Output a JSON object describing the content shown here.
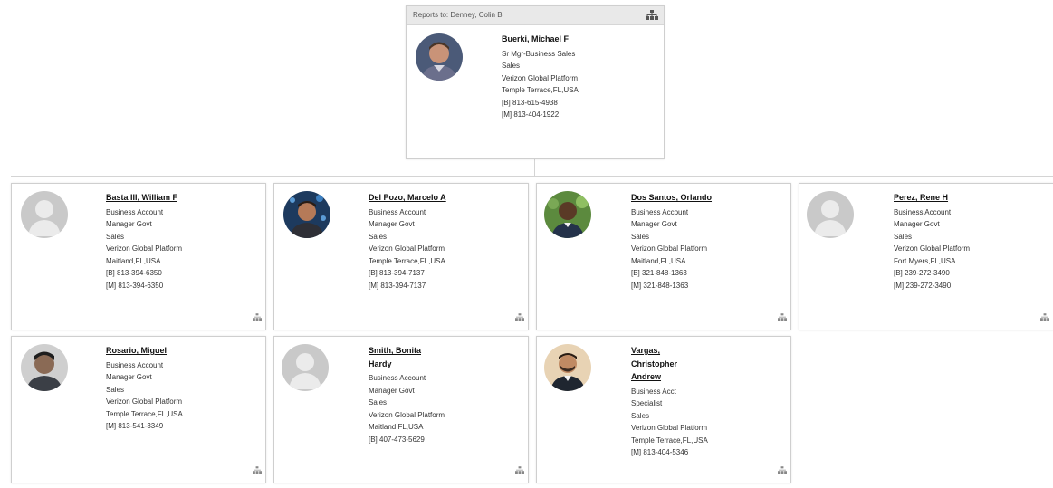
{
  "manager": {
    "reports_to": "Reports to: Denney, Colin B",
    "name": "Buerki, Michael F",
    "title": "Sr Mgr-Business Sales",
    "department": "Sales",
    "org": "Verizon Global Platform",
    "location": "Temple Terrace,FL,USA",
    "phone_b": "[B] 813-615-4938",
    "phone_m": "[M] 813-404-1922"
  },
  "reports": [
    {
      "name": "Basta III, William F",
      "title_lines": [
        "Business Account",
        "Manager Govt"
      ],
      "department": "Sales",
      "org": "Verizon Global Platform",
      "location": "Maitland,FL,USA",
      "phones": [
        "[B] 813-394-6350",
        "[M] 813-394-6350"
      ],
      "avatar": "placeholder"
    },
    {
      "name": "Del Pozo, Marcelo A",
      "title_lines": [
        "Business Account",
        "Manager Govt"
      ],
      "department": "Sales",
      "org": "Verizon Global Platform",
      "location": "Temple Terrace,FL,USA",
      "phones": [
        "[B] 813-394-7137",
        "[M] 813-394-7137"
      ],
      "avatar": "photo"
    },
    {
      "name": "Dos Santos, Orlando",
      "title_lines": [
        "Business Account",
        "Manager Govt"
      ],
      "department": "Sales",
      "org": "Verizon Global Platform",
      "location": "Maitland,FL,USA",
      "phones": [
        "[B] 321-848-1363",
        "[M] 321-848-1363"
      ],
      "avatar": "photo"
    },
    {
      "name": "Perez, Rene H",
      "title_lines": [
        "Business Account",
        "Manager Govt"
      ],
      "department": "Sales",
      "org": "Verizon Global Platform",
      "location": "Fort Myers,FL,USA",
      "phones": [
        "[B] 239-272-3490",
        "[M] 239-272-3490"
      ],
      "avatar": "placeholder"
    },
    {
      "name": "Rosario, Miguel",
      "title_lines": [
        "Business Account",
        "Manager Govt"
      ],
      "department": "Sales",
      "org": "Verizon Global Platform",
      "location": "Temple Terrace,FL,USA",
      "phones": [
        "[M] 813-541-3349"
      ],
      "avatar": "photo"
    },
    {
      "name": "Smith, Bonita Hardy",
      "title_lines": [
        "Business Account",
        "Manager Govt"
      ],
      "department": "Sales",
      "org": "Verizon Global Platform",
      "location": "Maitland,FL,USA",
      "phones": [
        "[B] 407-473-5629"
      ],
      "avatar": "placeholder"
    },
    {
      "name": "Vargas, Christopher Andrew",
      "title_lines": [
        "Business Acct",
        "Specialist"
      ],
      "department": "Sales",
      "org": "Verizon Global Platform",
      "location": "Temple Terrace,FL,USA",
      "phones": [
        "[M] 813-404-5346"
      ],
      "avatar": "photo"
    }
  ],
  "colors": {
    "border": "#cfcfcf",
    "header_bg": "#e9e9e9",
    "text": "#333333"
  },
  "icons": {
    "org_chart": "org-chart-icon"
  }
}
